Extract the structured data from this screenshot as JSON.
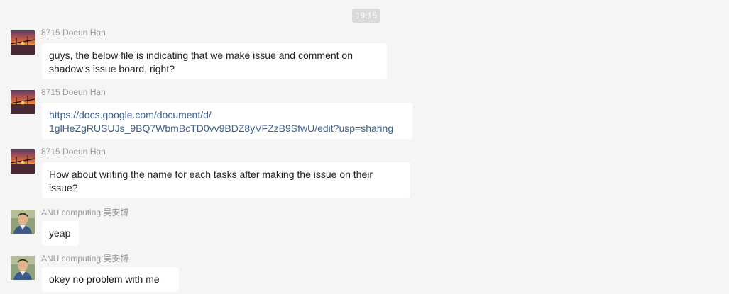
{
  "timestamp": "19:15",
  "messages": [
    {
      "sender": "8715 Doeun Han",
      "lines": [
        "guys, the below file is indicating that we make issue and comment on",
        "shadow's issue board, right?"
      ]
    },
    {
      "sender": "8715 Doeun Han",
      "link_lines": [
        "https://docs.google.com/document/d/",
        "1glHeZgRUSUJs_9BQ7WbmBcTD0vv9BDZ8yVFZzB9SfwU/edit?usp=sharing"
      ]
    },
    {
      "sender": "8715 Doeun Han",
      "lines": [
        "How about writing the name for each tasks after making the issue on their",
        "issue?"
      ]
    },
    {
      "sender": "ANU computing 吴安博",
      "lines": [
        "yeap"
      ]
    },
    {
      "sender": "ANU computing 吴安博",
      "lines": [
        "okey no problem with me"
      ]
    }
  ],
  "avatars": {
    "doeun": "sunset-bridge-avatar",
    "anu": "person-photo-avatar"
  }
}
